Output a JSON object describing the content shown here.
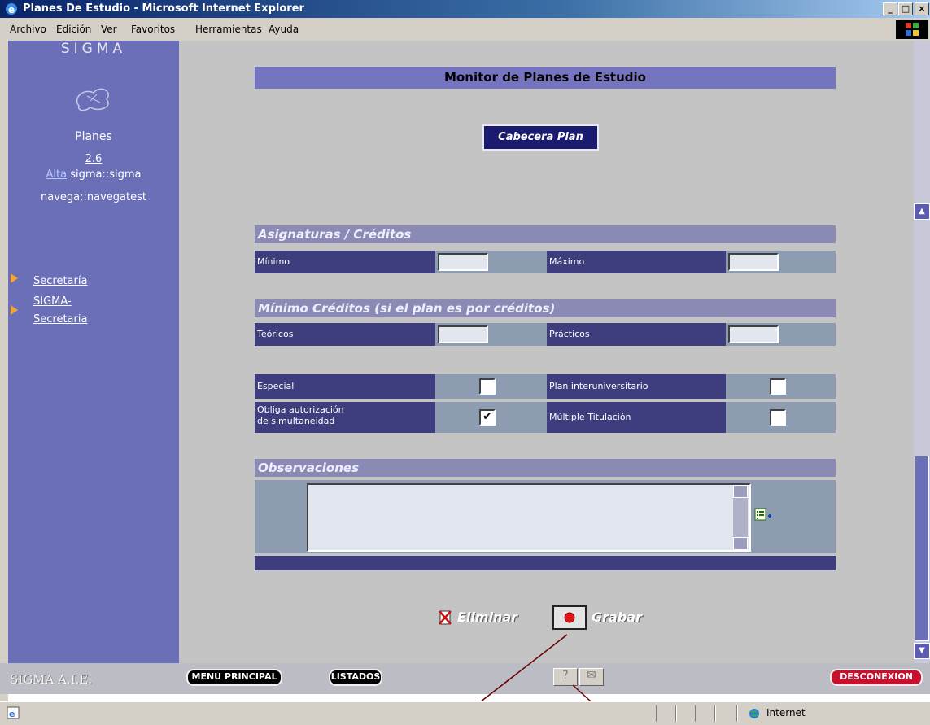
{
  "window": {
    "title": "Planes De Estudio - Microsoft Internet Explorer"
  },
  "menu": [
    "Archivo",
    "Edición",
    "Ver",
    "Favoritos",
    "Herramientas",
    "Ayuda"
  ],
  "sidebar": {
    "brand": "SIGMA",
    "app_name": "Planes",
    "version": "2.6",
    "alta_link": "Alta",
    "alta_user": "sigma::sigma",
    "navega": "navega::navegatest",
    "nav": [
      "Secretaría",
      "SIGMA-",
      "Secretaria"
    ]
  },
  "main": {
    "title": "Monitor de Planes de Estudio",
    "cabecera_button": "Cabecera Plan",
    "section_asignaturas": "Asignaturas / Créditos",
    "minimo": "Mínimo",
    "maximo": "Máximo",
    "section_min_creditos": "Mínimo Créditos (si el plan es por créditos)",
    "teoricos": "Teóricos",
    "practicos": "Prácticos",
    "especial": "Especial",
    "plan_interuniversitario": "Plan interuniversitario",
    "obliga_1": "Obliga autorización",
    "obliga_2": "de simultaneidad",
    "multiple_titulacion": "Múltiple Titulación",
    "checked_obliga": "✔",
    "section_observaciones": "Observaciones",
    "eliminar": "Eliminar",
    "grabar": "Grabar"
  },
  "bottom": {
    "brand": "SIGMA A.I.E.",
    "menu_principal": "MENU PRINCIPAL",
    "listados": "LISTADOS",
    "help": "?",
    "mail": "✉",
    "desconexion": "DESCONEXION"
  },
  "status": {
    "zone": "Internet"
  }
}
